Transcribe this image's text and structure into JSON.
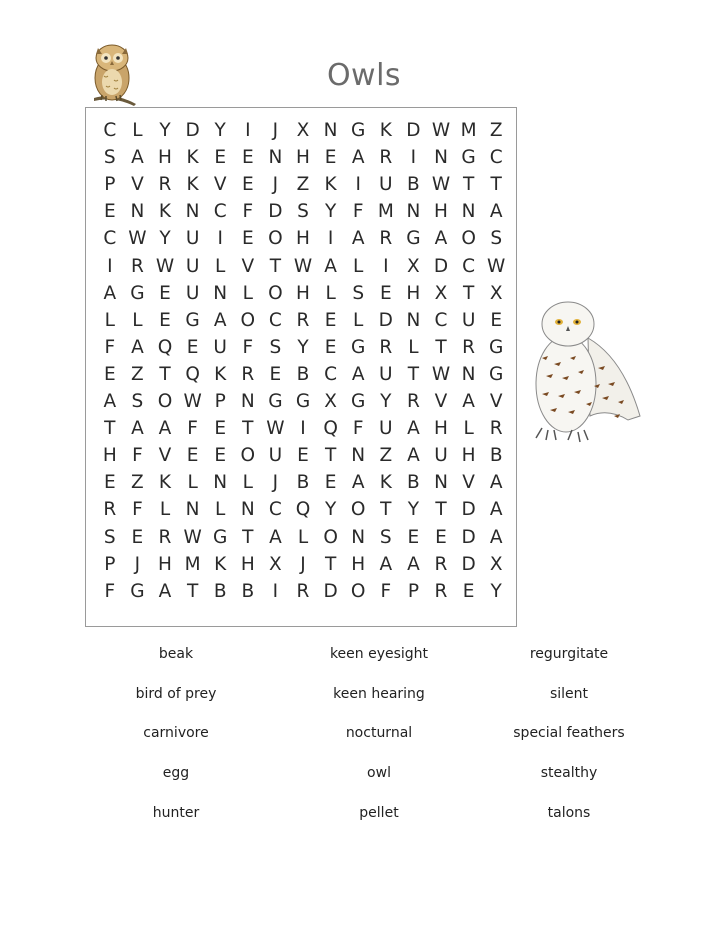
{
  "title": "Owls",
  "grid": [
    "CLYDYIJXNGKDWMZ",
    "SAHKEENHEARINGC",
    "PVRKVEJZKIUBWTT",
    "ENKNCFDSYFMNHNA",
    "CWYUIEOHIARGAOS",
    "IRWULVTWALIXDCW",
    "AGEUNLOHLSEHXTX",
    "LLEGAOCRELDNCUE",
    "FAQEUFSYEGRLTRG",
    "EZTQKREBCAUTWNG",
    "ASOWPNGGXGYRVAV",
    "TAAFETWIQFUAHLR",
    "HFVEEOUETNZAUHB",
    "EZKLNLJBEAKBNVA",
    "RFLNLNCQYOTYTDA",
    "SERWGTALONSEEDA",
    "PJHMKHXJTHAARDX",
    "FGATBBIRDOFPREY"
  ],
  "words": [
    "beak",
    "keen eyesight",
    "regurgitate",
    "bird of prey",
    "keen hearing",
    "silent",
    "carnivore",
    "nocturnal",
    "special feathers",
    "egg",
    "owl",
    "stealthy",
    "hunter",
    "pellet",
    "talons"
  ],
  "images": {
    "owl_small": "owl-small-icon",
    "owl_large": "snowy-owl-icon"
  }
}
